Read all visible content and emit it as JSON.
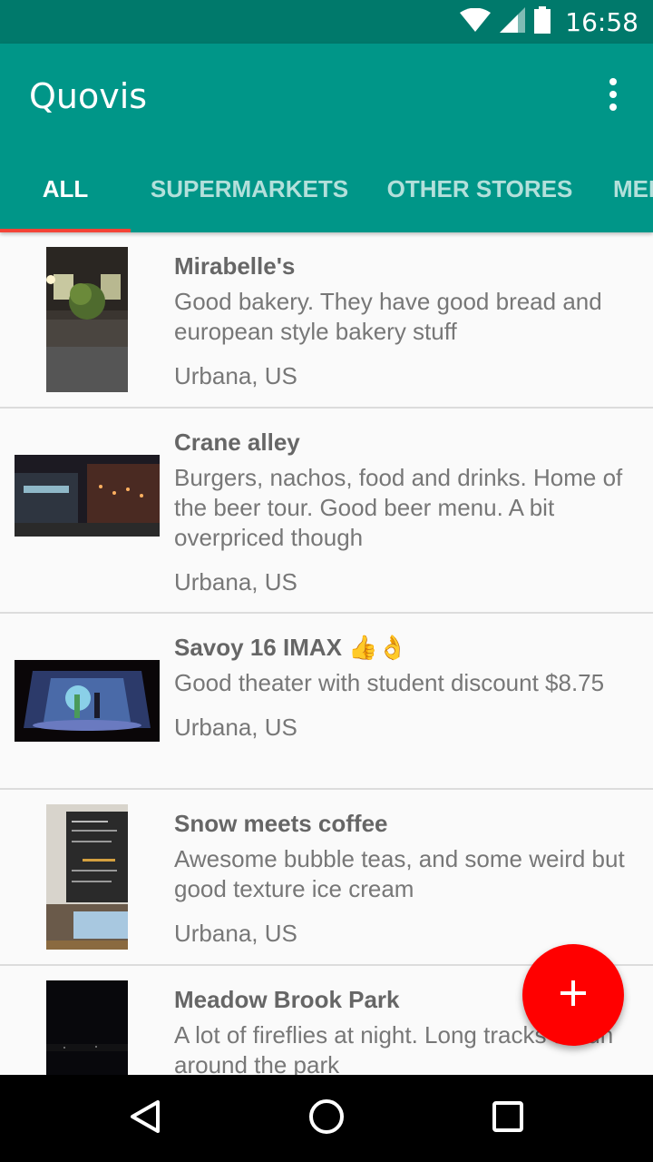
{
  "status_bar": {
    "time": "16:58",
    "icons": [
      "wifi-icon",
      "cell-signal-icon",
      "battery-icon"
    ]
  },
  "app_bar": {
    "title": "Quovis",
    "overflow_icon": "more-vert-icon"
  },
  "tabs": [
    {
      "label": "ALL",
      "active": true
    },
    {
      "label": "SUPERMARKETS",
      "active": false
    },
    {
      "label": "OTHER STORES",
      "active": false
    },
    {
      "label": "MEDICAL",
      "active": false
    }
  ],
  "places": [
    {
      "name": "Mirabelle's",
      "description": "Good bakery. They have good bread and european style bakery stuff",
      "location": "Urbana, US"
    },
    {
      "name": "Crane alley",
      "description": "Burgers, nachos, food and drinks. Home of the beer tour. Good beer menu. A bit overpriced though",
      "location": "Urbana, US"
    },
    {
      "name": "Savoy 16 IMAX 👍👌",
      "description": "Good theater with student discount $8.75",
      "location": "Urbana, US"
    },
    {
      "name": "Snow meets coffee",
      "description": "Awesome bubble teas, and some weird but good texture ice cream",
      "location": "Urbana, US"
    },
    {
      "name": "Meadow Brook Park",
      "description": "A lot of fireflies at night. Long tracks to run around the park",
      "location": ""
    }
  ],
  "fab": {
    "icon": "add-icon"
  },
  "nav_bar": {
    "icons": [
      "back-icon",
      "home-icon",
      "recents-icon"
    ]
  },
  "colors": {
    "primary": "#009688",
    "primary_dark": "#00796b",
    "accent": "#f44336",
    "fab": "#ff0000"
  }
}
